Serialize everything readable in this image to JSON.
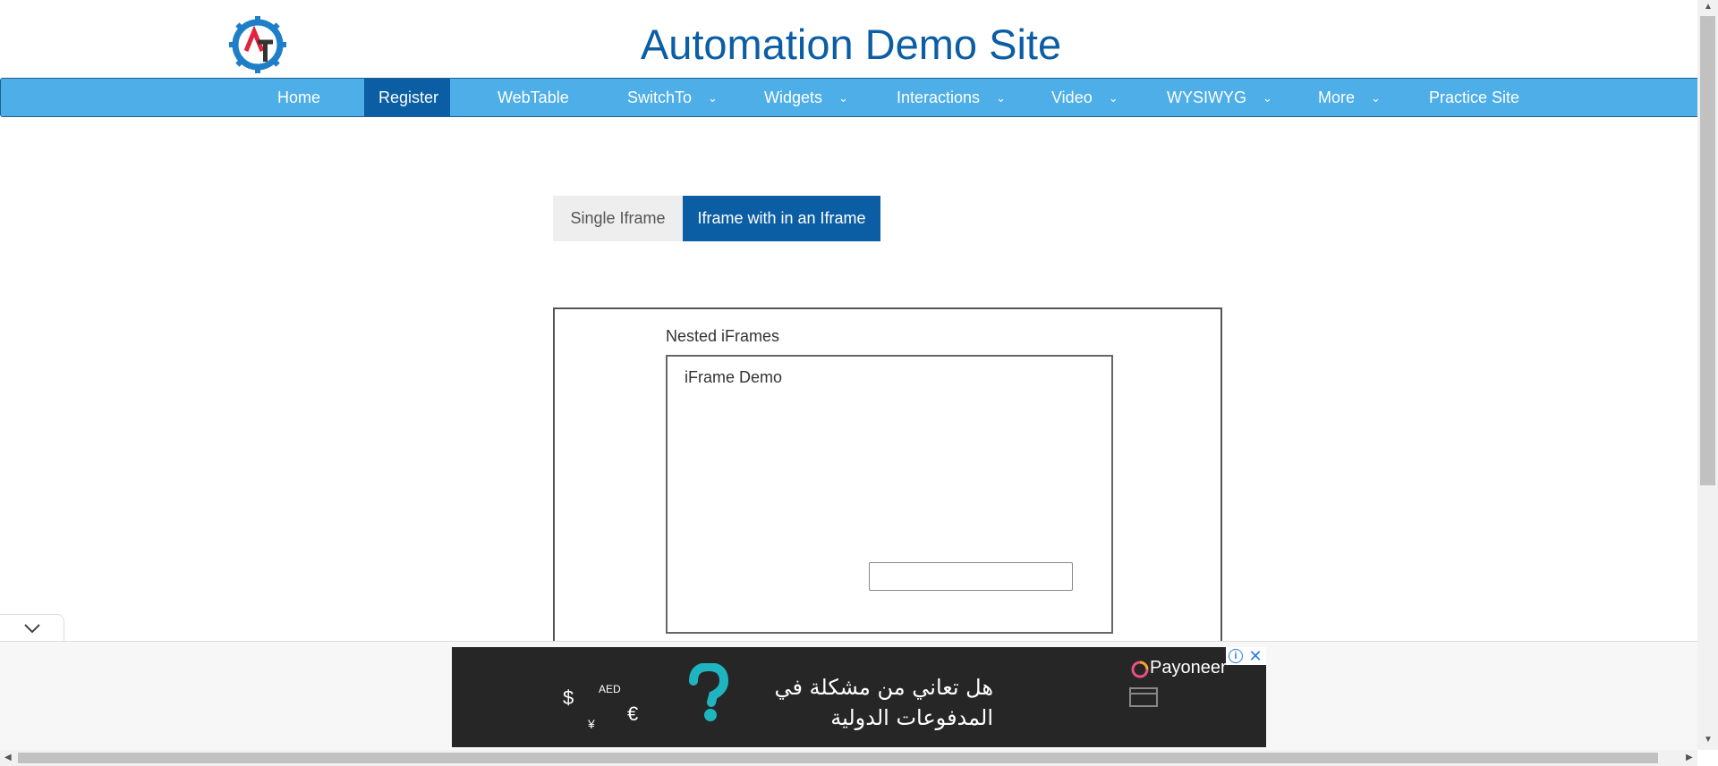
{
  "header": {
    "title": "Automation Demo Site"
  },
  "nav": {
    "items": [
      {
        "label": "Home"
      },
      {
        "label": "Register"
      },
      {
        "label": "WebTable"
      },
      {
        "label": "SwitchTo"
      },
      {
        "label": "Widgets"
      },
      {
        "label": "Interactions"
      },
      {
        "label": "Video"
      },
      {
        "label": "WYSIWYG"
      },
      {
        "label": "More"
      },
      {
        "label": "Practice Site"
      }
    ],
    "active": "Register"
  },
  "tabs": [
    {
      "label": "Single Iframe"
    },
    {
      "label": "Iframe with in an Iframe"
    }
  ],
  "frames": {
    "outer_label": "Nested iFrames",
    "inner_label": "iFrame Demo"
  },
  "ad": {
    "brand": "Payoneer",
    "line1": "هل تعاني من مشكلة في",
    "line2": "المدفوعات الدولية",
    "symbols": [
      "$",
      "AED",
      "¥",
      "€"
    ]
  },
  "colors": {
    "brand": "#0b5ea4",
    "nav": "#4daee8"
  }
}
